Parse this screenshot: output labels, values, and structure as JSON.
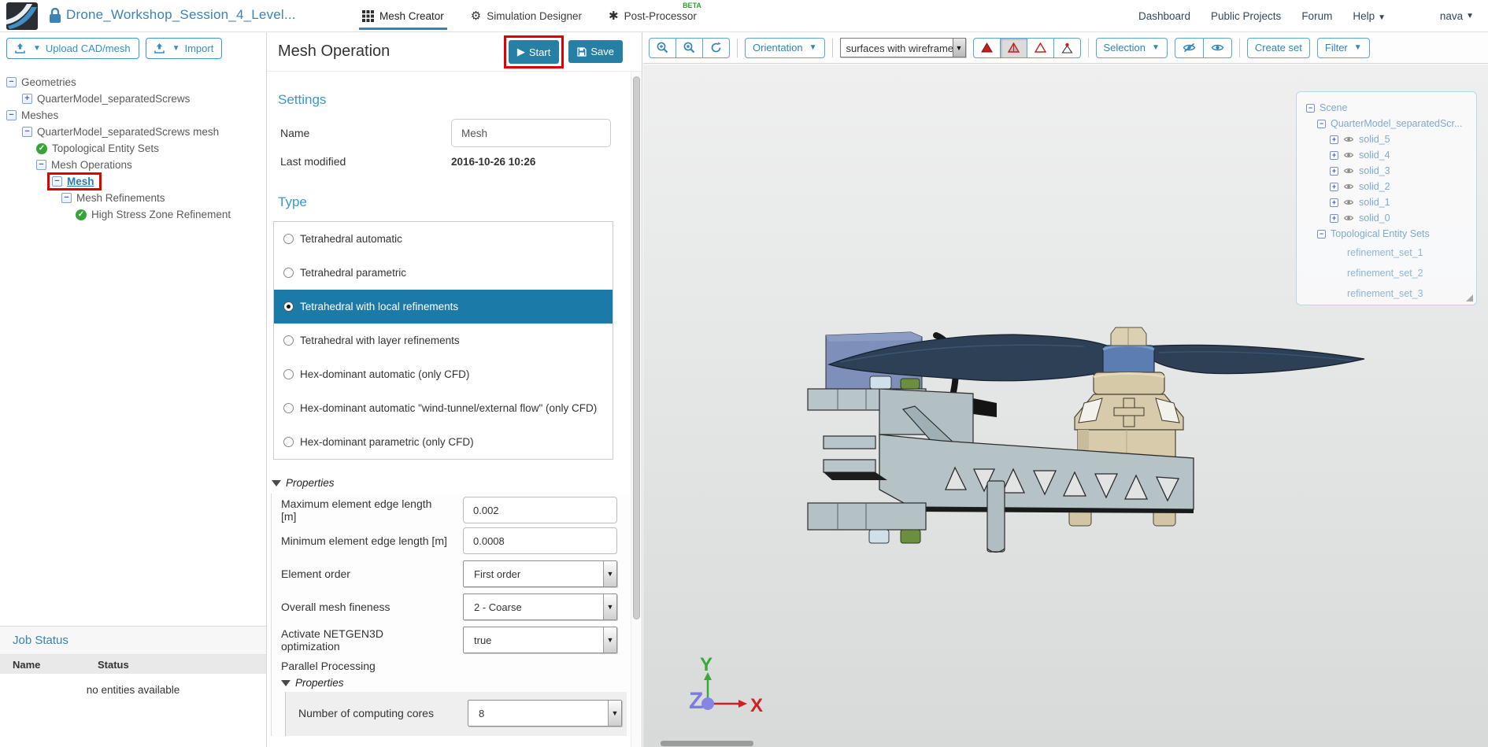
{
  "colors": {
    "accent_blue": "#3090c7",
    "title_blue": "#3b82b8",
    "button_teal": "#2680a6",
    "selected_row_blue": "#1b7aa7",
    "beta_green": "#2fa132",
    "check_green": "#37a437",
    "highlight_red": "#e00000",
    "scene_text_blue": "#7fa9cd",
    "axis_x_red": "#cc2222",
    "axis_y_green": "#3aa83a",
    "axis_z_blue": "#7b7be0"
  },
  "navbar": {
    "project_title": "Drone_Workshop_Session_4_Level...",
    "tabs": [
      {
        "label": "Mesh Creator"
      },
      {
        "label": "Simulation Designer"
      },
      {
        "label": "Post-Processor",
        "badge": "BETA"
      }
    ],
    "links": [
      {
        "label": "Dashboard"
      },
      {
        "label": "Public Projects"
      },
      {
        "label": "Forum"
      },
      {
        "label": "Help"
      }
    ],
    "user": "nava"
  },
  "left_panel": {
    "upload_button": "Upload CAD/mesh",
    "import_button": "Import",
    "tree": [
      {
        "label": "Geometries"
      },
      {
        "label": "QuarterModel_separatedScrews"
      },
      {
        "label": "Meshes"
      },
      {
        "label": "QuarterModel_separatedScrews mesh"
      },
      {
        "label": "Topological Entity Sets"
      },
      {
        "label": "Mesh Operations"
      },
      {
        "label": "Mesh"
      },
      {
        "label": "Mesh Refinements"
      },
      {
        "label": "High Stress Zone Refinement"
      }
    ],
    "job_status": {
      "title": "Job Status",
      "name_col": "Name",
      "status_col": "Status",
      "empty_text": "no entities available"
    }
  },
  "operation_panel": {
    "title": "Mesh Operation",
    "start_button": "Start",
    "save_button": "Save",
    "settings_heading": "Settings",
    "name_label": "Name",
    "name_value": "Mesh",
    "last_modified_label": "Last modified",
    "last_modified_value": "2016-10-26 10:26",
    "type_heading": "Type",
    "type_options": [
      {
        "label": "Tetrahedral automatic"
      },
      {
        "label": "Tetrahedral parametric"
      },
      {
        "label": "Tetrahedral with local refinements"
      },
      {
        "label": "Tetrahedral with layer refinements"
      },
      {
        "label": "Hex-dominant automatic (only CFD)"
      },
      {
        "label": "Hex-dominant automatic \"wind-tunnel/external flow\" (only CFD)"
      },
      {
        "label": "Hex-dominant parametric (only CFD)"
      }
    ],
    "selected_type_index": 2,
    "properties_heading": "Properties",
    "properties": [
      {
        "label": "Maximum element edge length [m]",
        "value": "0.002"
      },
      {
        "label": "Minimum element edge length [m]",
        "value": "0.0008"
      },
      {
        "label": "Element order",
        "value": "First order"
      },
      {
        "label": "Overall mesh fineness",
        "value": "2 - Coarse"
      },
      {
        "label": "Activate NETGEN3D optimization",
        "value": "true"
      }
    ],
    "parallel_label": "Parallel Processing",
    "nested_properties_heading": "Properties",
    "cores_label": "Number of computing cores",
    "cores_value": "8"
  },
  "viewer": {
    "toolbar": {
      "orientation_button": "Orientation",
      "render_mode_value": "surfaces with wireframe",
      "selection_button": "Selection",
      "create_set_button": "Create set",
      "filter_button": "Filter"
    },
    "scene_tree": {
      "root": "Scene",
      "model": "QuarterModel_separatedScr...",
      "solids": [
        {
          "label": "solid_5"
        },
        {
          "label": "solid_4"
        },
        {
          "label": "solid_3"
        },
        {
          "label": "solid_2"
        },
        {
          "label": "solid_1"
        },
        {
          "label": "solid_0"
        }
      ],
      "sets_heading": "Topological Entity Sets",
      "sets": [
        {
          "label": "refinement_set_1"
        },
        {
          "label": "refinement_set_2"
        },
        {
          "label": "refinement_set_3"
        }
      ]
    },
    "axis": {
      "x": "X",
      "y": "Y",
      "z": "Z"
    }
  }
}
